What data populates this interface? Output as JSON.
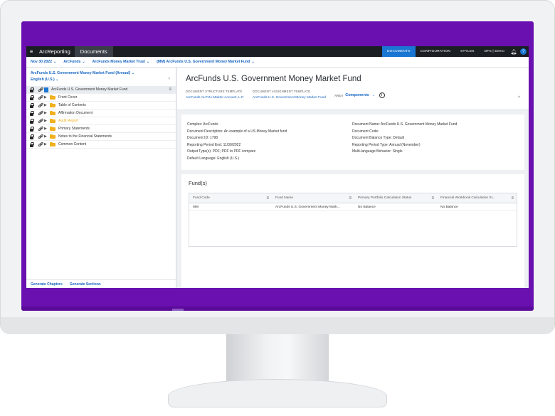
{
  "app": {
    "brand": "ArcReporting",
    "section_tab": "Documents",
    "nav_tabs": [
      "DOCUMENTS",
      "CONFIGURATION",
      "STYLES",
      "DFS | Demo"
    ],
    "help_glyph": "?"
  },
  "filters": [
    {
      "label": "Nov 30 2022"
    },
    {
      "label": "ArcFunds"
    },
    {
      "label": "ArcFunds Money Market Trust"
    },
    {
      "label": "(MM) ArcFunds U.S. Government Money Market Fund"
    }
  ],
  "left_panel": {
    "document_title": "ArcFunds U.S. Government Money Market Fund (Annual)",
    "language": "English (U.S.)",
    "root_item": "ArcFunds U.S. Government Money Market Fund",
    "items": [
      {
        "label": "Front Cover",
        "color": "#333333"
      },
      {
        "label": "Table of Contents",
        "color": "#333333"
      },
      {
        "label": "Affirmation Document",
        "color": "#333333"
      },
      {
        "label": "Audit Report",
        "color": "#f2b01e"
      },
      {
        "label": "Primary Statements",
        "color": "#333333"
      },
      {
        "label": "Notes to the Financial Statements",
        "color": "#333333"
      },
      {
        "label": "Common Content",
        "color": "#333333"
      }
    ],
    "footer_links": [
      "Generate Chapters",
      "Generate Sections"
    ]
  },
  "header": {
    "title": "ArcFunds U.S. Government Money Market Fund",
    "structure_template_label": "DOCUMENT STRUCTURE TEMPLATE",
    "structure_template_value": "ArcFunds ALPHA Master Account, L.P.",
    "assignment_template_label": "DOCUMENT ASSIGNMENT TEMPLATE",
    "assignment_template_value": "ArcFunds U.S. Government Money Market Fund",
    "area_label": "AREA",
    "area_value": "Components"
  },
  "details": {
    "left": [
      "Complex: ArcFunds",
      "Document Description: An example of a US Money Market fund",
      "Document ID: 1798",
      "Reporting Period End: 11/30/2022",
      "Output Type(s): PDF; PDF to PDF compare",
      "Default Language: English (U.S.)"
    ],
    "right": [
      "Document Name: ArcFunds U.S. Government Money Market Fund",
      "Document Code:",
      "Document Balance Type: Default",
      "Reporting Period Type: Annual (November)",
      "Multi-language Behavior: Single"
    ]
  },
  "funds": {
    "title": "Fund(s)",
    "columns": [
      "Fund Code",
      "Fund Name",
      "Primary Portfolio Calculation Status",
      "Financial Workbook Calculation St..."
    ],
    "rows": [
      [
        "MM",
        "ArcFunds U.S. Government Money Mark...",
        "No Balance",
        "No Balance"
      ]
    ]
  }
}
